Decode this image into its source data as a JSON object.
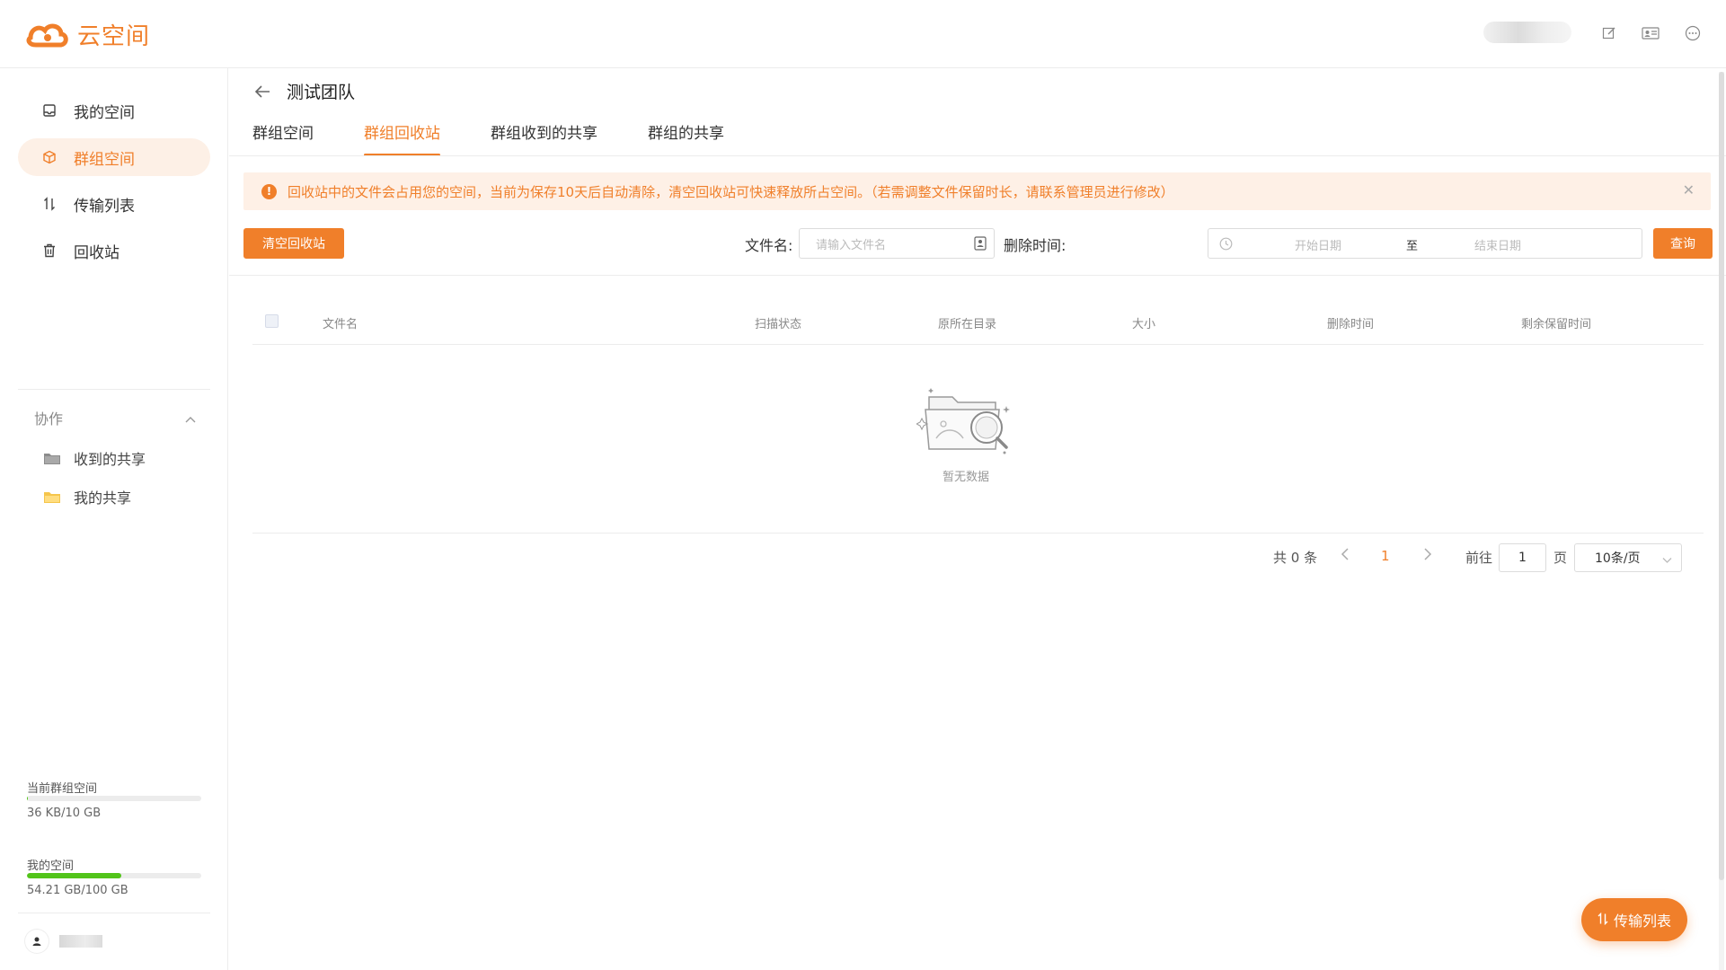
{
  "app": {
    "name": "云空间"
  },
  "sidebar": {
    "items": [
      {
        "label": "我的空间",
        "icon": "inbox-icon"
      },
      {
        "label": "群组空间",
        "icon": "cube-icon"
      },
      {
        "label": "传输列表",
        "icon": "transfer-icon"
      },
      {
        "label": "回收站",
        "icon": "trash-icon"
      }
    ],
    "active_index": 1,
    "collab": {
      "title": "协作",
      "items": [
        {
          "label": "收到的共享",
          "icon": "folder-icon",
          "color": "#7f7f7f"
        },
        {
          "label": "我的共享",
          "icon": "folder-icon",
          "color": "#f5c54b"
        }
      ]
    },
    "storage": [
      {
        "label": "当前群组空间",
        "value": "36 KB/10 GB",
        "fraction": 0.004
      },
      {
        "label": "我的空间",
        "value": "54.21 GB/100 GB",
        "fraction": 0.5421
      }
    ]
  },
  "main": {
    "title": "测试团队",
    "tabs": [
      "群组空间",
      "群组回收站",
      "群组收到的共享",
      "群组的共享"
    ],
    "active_tab": 1,
    "alert": "回收站中的文件会占用您的空间，当前为保存10天后自动清除，清空回收站可快速释放所占空间。（若需调整文件保留时长，请联系管理员进行修改）",
    "clear_button": "清空回收站",
    "filters": {
      "filename_label": "文件名:",
      "filename_placeholder": "请输入文件名",
      "delete_time_label": "删除时间:",
      "start_placeholder": "开始日期",
      "range_separator": "至",
      "end_placeholder": "结束日期",
      "query_button": "查询"
    },
    "table": {
      "columns": [
        "文件名",
        "扫描状态",
        "原所在目录",
        "大小",
        "删除时间",
        "剩余保留时间"
      ],
      "rows": [],
      "empty_text": "暂无数据"
    },
    "pagination": {
      "total_text": "共 0 条",
      "current_page": "1",
      "goto_label": "前往",
      "goto_value": "1",
      "page_suffix": "页",
      "page_size": "10条/页"
    }
  },
  "float_button": "传输列表",
  "colors": {
    "accent": "#f07f2a",
    "alert_bg": "#fef0e6",
    "storage_fill": "#52c41a"
  }
}
